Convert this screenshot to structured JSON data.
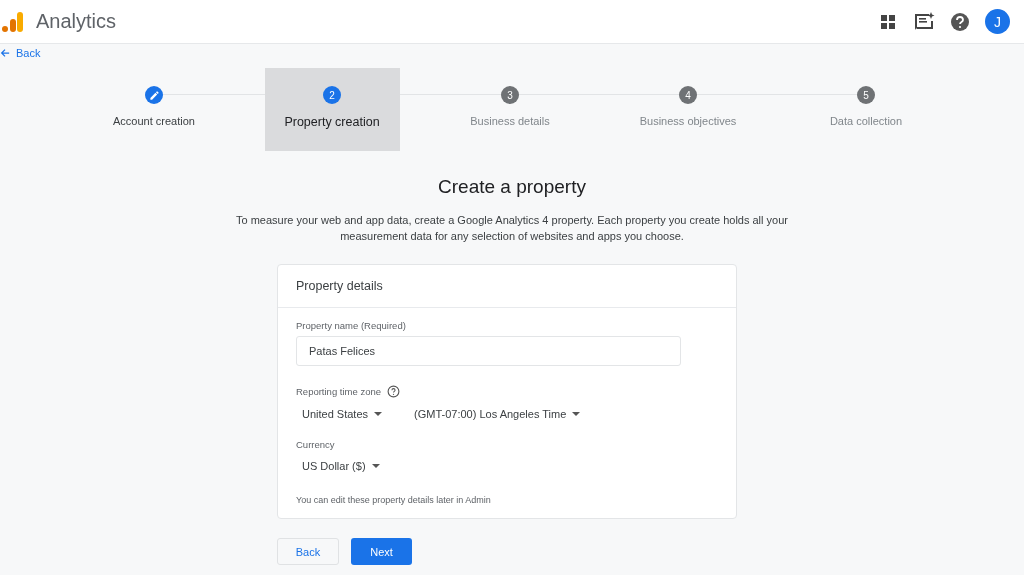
{
  "app_bar": {
    "title": "Analytics",
    "avatar": "J"
  },
  "back_link": "Back",
  "steps": [
    {
      "label": "Account creation",
      "kind": "done",
      "selected": false
    },
    {
      "label": "Property creation",
      "number": "2",
      "kind": "current",
      "selected": true
    },
    {
      "label": "Business details",
      "number": "3",
      "kind": "upcoming",
      "selected": false
    },
    {
      "label": "Business objectives",
      "number": "4",
      "kind": "upcoming",
      "selected": false
    },
    {
      "label": "Data collection",
      "number": "5",
      "kind": "upcoming",
      "selected": false
    }
  ],
  "heading": "Create a property",
  "description": "To measure your web and app data, create a Google Analytics 4 property. Each property you create holds all your measurement data for any selection of websites and apps you choose.",
  "card": {
    "title": "Property details",
    "property_name": {
      "label": "Property name (Required)",
      "value": "Patas Felices"
    },
    "time_zone": {
      "label": "Reporting time zone",
      "country": "United States",
      "zone": "(GMT-07:00) Los Angeles Time"
    },
    "currency": {
      "label": "Currency",
      "value": "US Dollar ($)"
    },
    "note": "You can edit these property details later in Admin"
  },
  "buttons": {
    "back": "Back",
    "next": "Next"
  }
}
